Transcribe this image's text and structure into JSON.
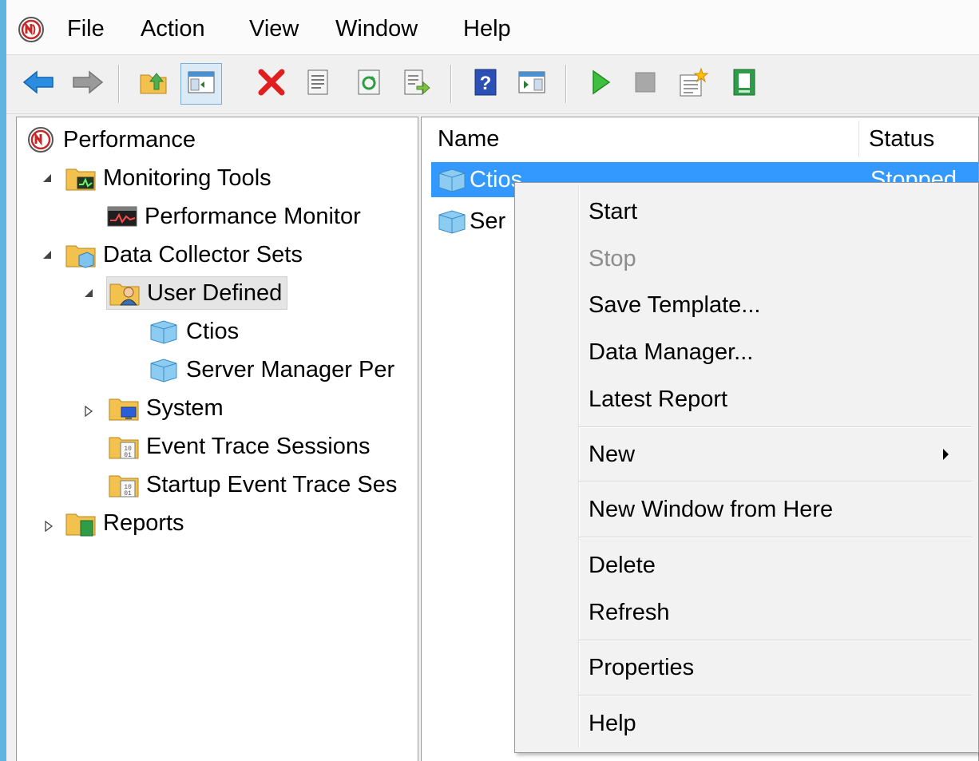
{
  "menubar": {
    "items": [
      "File",
      "Action",
      "View",
      "Window",
      "Help"
    ]
  },
  "toolbar": {
    "buttons": [
      "back-icon",
      "forward-icon",
      "up-folder-icon",
      "show-hide-tree-icon",
      "delete-icon",
      "properties-icon",
      "refresh-icon",
      "export-list-icon",
      "help-icon",
      "show-action-pane-icon",
      "start-icon",
      "stop-icon",
      "new-collector-icon",
      "report-icon"
    ]
  },
  "tree": {
    "root": "Performance",
    "monitoring_tools": "Monitoring Tools",
    "performance_monitor": "Performance Monitor",
    "data_collector_sets": "Data Collector Sets",
    "user_defined": "User Defined",
    "ctios": "Ctios",
    "server_manager": "Server Manager Per",
    "system": "System",
    "event_trace_sessions": "Event Trace Sessions",
    "startup_event_trace": "Startup Event Trace Ses",
    "reports": "Reports"
  },
  "list": {
    "columns": [
      "Name",
      "Status"
    ],
    "rows": [
      {
        "name": "Ctios",
        "status": "Stopped"
      },
      {
        "name": "Ser",
        "status": ""
      }
    ]
  },
  "context_menu": {
    "items": [
      "Start",
      "Stop",
      "Save Template...",
      "Data Manager...",
      "Latest Report",
      "New",
      "New Window from Here",
      "Delete",
      "Refresh",
      "Properties",
      "Help"
    ]
  },
  "colors": {
    "selection": "#3399ff",
    "accent_bar": "#5fb5e0",
    "disabled_text": "#8d8d8d"
  }
}
